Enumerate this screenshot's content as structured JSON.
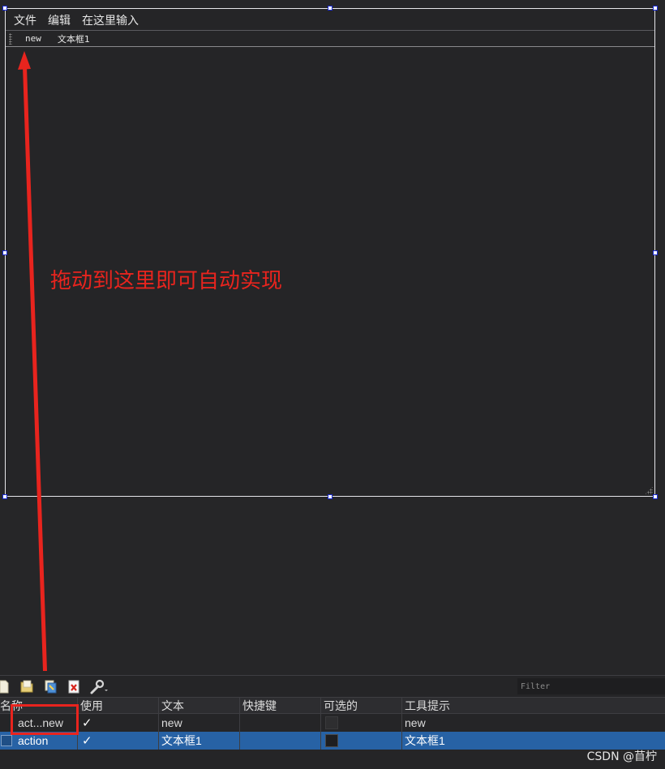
{
  "form": {
    "menu_items": [
      "文件",
      "编辑",
      "在这里输入"
    ],
    "toolbar_actions": [
      "new",
      "文本框1"
    ]
  },
  "annotation": {
    "text": "拖动到这里即可自动实现",
    "color": "#e8241e"
  },
  "action_editor": {
    "toolbar_icons": [
      "new-action-icon",
      "open-folder-icon",
      "copy-action-icon",
      "delete-action-icon",
      "properties-wrench-icon"
    ],
    "filter_placeholder": "Filter",
    "columns": [
      "名称",
      "使用",
      "文本",
      "快捷键",
      "可选的",
      "工具提示"
    ],
    "rows": [
      {
        "name": "act...new",
        "used": "✓",
        "text": "new",
        "shortcut": "",
        "checkable": false,
        "tooltip": "new",
        "selected": false
      },
      {
        "name": "action",
        "used": "✓",
        "text": "文本框1",
        "shortcut": "",
        "checkable": false,
        "tooltip": "文本框1",
        "selected": true
      }
    ]
  },
  "watermark": "CSDN @苜柠",
  "colors": {
    "background": "#262628",
    "selection": "#2762a5",
    "annotation_red": "#e8241e"
  }
}
